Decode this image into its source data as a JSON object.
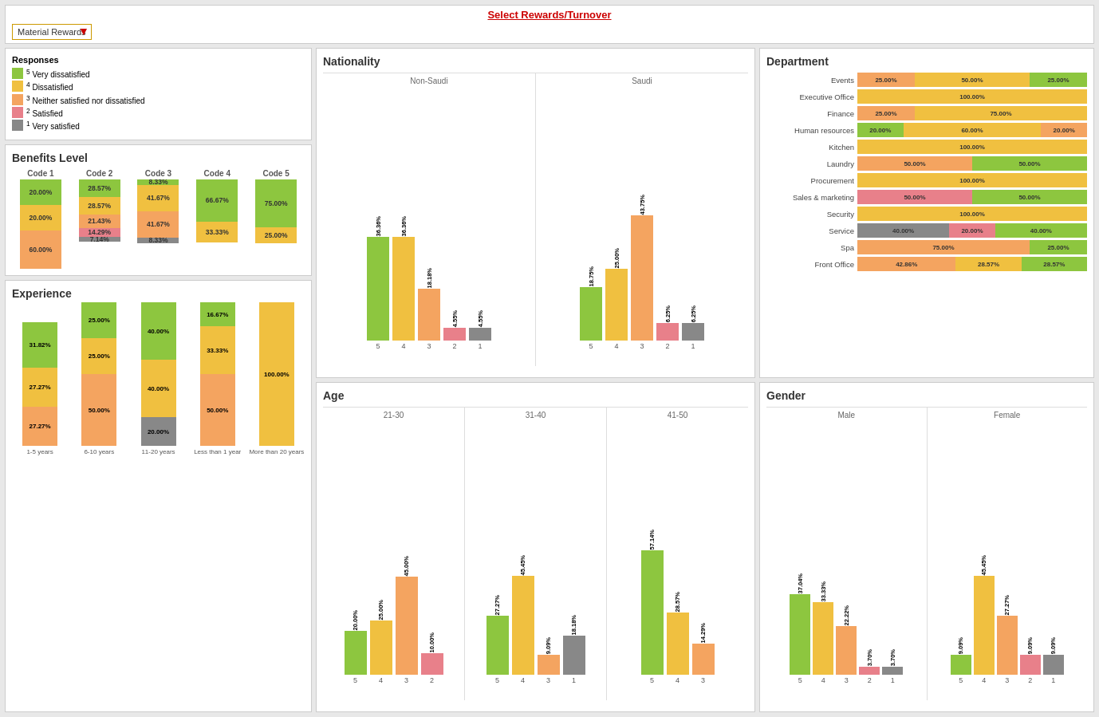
{
  "header": {
    "title": "Select Rewards/Turnover",
    "dropdown_label": "Material Rewards",
    "dropdown_value": "Material Rewards"
  },
  "legend": {
    "title": "Responses",
    "items": [
      {
        "sup": "5",
        "label": "Very dissatisfied",
        "color": "green"
      },
      {
        "sup": "4",
        "label": "Dissatisfied",
        "color": "yellow"
      },
      {
        "sup": "3",
        "label": "Neither satisfied nor dissatisfied",
        "color": "orange"
      },
      {
        "sup": "2",
        "label": "Satisfied",
        "color": "pink"
      },
      {
        "sup": "1",
        "label": "Very satisfied",
        "color": "gray"
      }
    ]
  },
  "benefits": {
    "title": "Benefits Level",
    "columns": [
      "Code 1",
      "Code 2",
      "Code 3",
      "Code 4",
      "Code 5"
    ],
    "data": [
      [
        "20.00%",
        "28.57%",
        "8.33%",
        "66.67%",
        "75.00%"
      ],
      [
        "20.00%",
        "28.57%",
        "41.67%",
        "33.33%",
        "25.00%"
      ],
      [
        "60.00%",
        "21.43%",
        "41.67%",
        "",
        ""
      ],
      [
        "",
        "14.29%",
        "",
        "",
        ""
      ],
      [
        "",
        "7.14%",
        "8.33%",
        "",
        ""
      ]
    ],
    "colors": [
      "green",
      "yellow",
      "orange",
      "pink",
      "gray"
    ]
  },
  "experience": {
    "title": "Experience",
    "groups": [
      {
        "label": "1-5 years",
        "segments": [
          {
            "pct": 31.82,
            "label": "31.82%",
            "color": "green",
            "height": 57
          },
          {
            "pct": 27.27,
            "label": "27.27%",
            "color": "yellow",
            "height": 49
          },
          {
            "pct": 27.27,
            "label": "27.27%",
            "color": "orange",
            "height": 49
          },
          {
            "pct": 0,
            "label": "",
            "color": "pink",
            "height": 0
          },
          {
            "pct": 0,
            "label": "",
            "color": "gray",
            "height": 0
          }
        ]
      },
      {
        "label": "6-10 years",
        "segments": [
          {
            "pct": 25.0,
            "label": "25.00%",
            "color": "green",
            "height": 45
          },
          {
            "pct": 25.0,
            "label": "25.00%",
            "color": "yellow",
            "height": 45
          },
          {
            "pct": 50.0,
            "label": "50.00%",
            "color": "orange",
            "height": 90
          },
          {
            "pct": 0,
            "label": "",
            "color": "pink",
            "height": 0
          },
          {
            "pct": 0,
            "label": "",
            "color": "gray",
            "height": 0
          }
        ]
      },
      {
        "label": "11-20 years",
        "segments": [
          {
            "pct": 40.0,
            "label": "40.00%",
            "color": "green",
            "height": 72
          },
          {
            "pct": 40.0,
            "label": "40.00%",
            "color": "yellow",
            "height": 72
          },
          {
            "pct": 0,
            "label": "",
            "color": "orange",
            "height": 0
          },
          {
            "pct": 0,
            "label": "",
            "color": "pink",
            "height": 0
          },
          {
            "pct": 20.0,
            "label": "20.00%",
            "color": "gray",
            "height": 36
          }
        ]
      },
      {
        "label": "Less than 1 year",
        "segments": [
          {
            "pct": 16.67,
            "label": "16.67%",
            "color": "green",
            "height": 30
          },
          {
            "pct": 33.33,
            "label": "33.33%",
            "color": "yellow",
            "height": 60
          },
          {
            "pct": 50.0,
            "label": "50.00%",
            "color": "orange",
            "height": 90
          },
          {
            "pct": 0,
            "label": "",
            "color": "pink",
            "height": 0
          },
          {
            "pct": 0,
            "label": "",
            "color": "gray",
            "height": 0
          }
        ]
      },
      {
        "label": "More than 20 years",
        "segments": [
          {
            "pct": 0,
            "label": "",
            "color": "green",
            "height": 0
          },
          {
            "pct": 100.0,
            "label": "100.00%",
            "color": "yellow",
            "height": 180
          },
          {
            "pct": 0,
            "label": "",
            "color": "orange",
            "height": 0
          },
          {
            "pct": 0,
            "label": "",
            "color": "pink",
            "height": 0
          },
          {
            "pct": 0,
            "label": "",
            "color": "gray",
            "height": 0
          }
        ]
      }
    ]
  },
  "nationality": {
    "title": "Nationality",
    "groups": [
      {
        "label": "Non-Saudi",
        "bars": [
          {
            "x": "5",
            "pct": "36.36%",
            "color": "green",
            "height": 130
          },
          {
            "x": "4",
            "pct": "36.36%",
            "color": "yellow",
            "height": 130
          },
          {
            "x": "3",
            "pct": "18.18%",
            "color": "orange",
            "height": 65
          },
          {
            "x": "2",
            "pct": "4.55%",
            "color": "pink",
            "height": 16
          },
          {
            "x": "1",
            "pct": "4.55%",
            "color": "gray",
            "height": 16
          }
        ]
      },
      {
        "label": "Saudi",
        "bars": [
          {
            "x": "5",
            "pct": "18.75%",
            "color": "green",
            "height": 67
          },
          {
            "x": "4",
            "pct": "25.00%",
            "color": "yellow",
            "height": 90
          },
          {
            "x": "3",
            "pct": "43.75%",
            "color": "orange",
            "height": 157
          },
          {
            "x": "2",
            "pct": "6.25%",
            "color": "pink",
            "height": 22
          },
          {
            "x": "1",
            "pct": "6.25%",
            "color": "gray",
            "height": 22
          }
        ]
      }
    ]
  },
  "age": {
    "title": "Age",
    "groups": [
      {
        "label": "21-30",
        "bars": [
          {
            "x": "5",
            "pct": "20.00%",
            "color": "green",
            "height": 55
          },
          {
            "x": "4",
            "pct": "25.00%",
            "color": "yellow",
            "height": 68
          },
          {
            "x": "3",
            "pct": "45.00%",
            "color": "orange",
            "height": 123
          },
          {
            "x": "2",
            "pct": "10.00%",
            "color": "pink",
            "height": 27
          }
        ]
      },
      {
        "label": "31-40",
        "bars": [
          {
            "x": "5",
            "pct": "27.27%",
            "color": "green",
            "height": 74
          },
          {
            "x": "4",
            "pct": "45.45%",
            "color": "yellow",
            "height": 124
          },
          {
            "x": "3",
            "pct": "9.09%",
            "color": "orange",
            "height": 25
          },
          {
            "x": "1",
            "pct": "18.18%",
            "color": "gray",
            "height": 49
          }
        ]
      },
      {
        "label": "41-50",
        "bars": [
          {
            "x": "5",
            "pct": "57.14%",
            "color": "green",
            "height": 156
          },
          {
            "x": "4",
            "pct": "28.57%",
            "color": "yellow",
            "height": 78
          },
          {
            "x": "3",
            "pct": "14.29%",
            "color": "orange",
            "height": 39
          }
        ]
      }
    ]
  },
  "gender": {
    "title": "Gender",
    "groups": [
      {
        "label": "Male",
        "bars": [
          {
            "x": "5",
            "pct": "37.04%",
            "color": "green",
            "height": 101
          },
          {
            "x": "4",
            "pct": "33.33%",
            "color": "yellow",
            "height": 91
          },
          {
            "x": "3",
            "pct": "22.22%",
            "color": "orange",
            "height": 61
          },
          {
            "x": "2",
            "pct": "3.70%",
            "color": "pink",
            "height": 10
          },
          {
            "x": "1",
            "pct": "3.70%",
            "color": "gray",
            "height": 10
          }
        ]
      },
      {
        "label": "Female",
        "bars": [
          {
            "x": "5",
            "pct": "9.09%",
            "color": "green",
            "height": 25
          },
          {
            "x": "4",
            "pct": "45.45%",
            "color": "yellow",
            "height": 124
          },
          {
            "x": "3",
            "pct": "27.27%",
            "color": "orange",
            "height": 74
          },
          {
            "x": "2",
            "pct": "9.09%",
            "color": "pink",
            "height": 25
          },
          {
            "x": "1",
            "pct": "9.09%",
            "color": "gray",
            "height": 25
          }
        ]
      }
    ]
  },
  "department": {
    "title": "Department",
    "rows": [
      {
        "label": "Events",
        "segments": [
          {
            "pct": 25,
            "label": "25.00%",
            "color": "orange"
          },
          {
            "pct": 50,
            "label": "50.00%",
            "color": "yellow"
          },
          {
            "pct": 25,
            "label": "25.00%",
            "color": "green"
          }
        ]
      },
      {
        "label": "Executive Office",
        "segments": [
          {
            "pct": 100,
            "label": "100.00%",
            "color": "yellow"
          }
        ]
      },
      {
        "label": "Finance",
        "segments": [
          {
            "pct": 25,
            "label": "25.00%",
            "color": "orange"
          },
          {
            "pct": 75,
            "label": "75.00%",
            "color": "yellow"
          }
        ]
      },
      {
        "label": "Human resources",
        "segments": [
          {
            "pct": 20,
            "label": "20.00%",
            "color": "green"
          },
          {
            "pct": 60,
            "label": "60.00%",
            "color": "yellow"
          },
          {
            "pct": 20,
            "label": "20.00%",
            "color": "orange"
          }
        ]
      },
      {
        "label": "Kitchen",
        "segments": [
          {
            "pct": 100,
            "label": "100.00%",
            "color": "yellow"
          }
        ]
      },
      {
        "label": "Laundry",
        "segments": [
          {
            "pct": 50,
            "label": "50.00%",
            "color": "orange"
          },
          {
            "pct": 50,
            "label": "50.00%",
            "color": "green"
          }
        ]
      },
      {
        "label": "Procurement",
        "segments": [
          {
            "pct": 100,
            "label": "100.00%",
            "color": "yellow"
          }
        ]
      },
      {
        "label": "Sales & marketing",
        "segments": [
          {
            "pct": 50,
            "label": "50.00%",
            "color": "pink"
          },
          {
            "pct": 50,
            "label": "50.00%",
            "color": "green"
          }
        ]
      },
      {
        "label": "Security",
        "segments": [
          {
            "pct": 100,
            "label": "100.00%",
            "color": "yellow"
          }
        ]
      },
      {
        "label": "Service",
        "segments": [
          {
            "pct": 40,
            "label": "40.00%",
            "color": "gray"
          },
          {
            "pct": 20,
            "label": "20.00%",
            "color": "pink"
          },
          {
            "pct": 40,
            "label": "40.00%",
            "color": "green"
          }
        ]
      },
      {
        "label": "Spa",
        "segments": [
          {
            "pct": 75,
            "label": "75.00%",
            "color": "orange"
          },
          {
            "pct": 25,
            "label": "25.00%",
            "color": "green"
          }
        ]
      },
      {
        "label": "Front Office",
        "segments": [
          {
            "pct": 42.86,
            "label": "42.86%",
            "color": "orange"
          },
          {
            "pct": 28.57,
            "label": "28.57%",
            "color": "yellow"
          },
          {
            "pct": 28.57,
            "label": "28.57%",
            "color": "green"
          }
        ]
      }
    ]
  },
  "colors": {
    "green": "#8dc63f",
    "yellow": "#f0c040",
    "orange": "#f4a460",
    "pink": "#e8808a",
    "gray": "#888888"
  }
}
